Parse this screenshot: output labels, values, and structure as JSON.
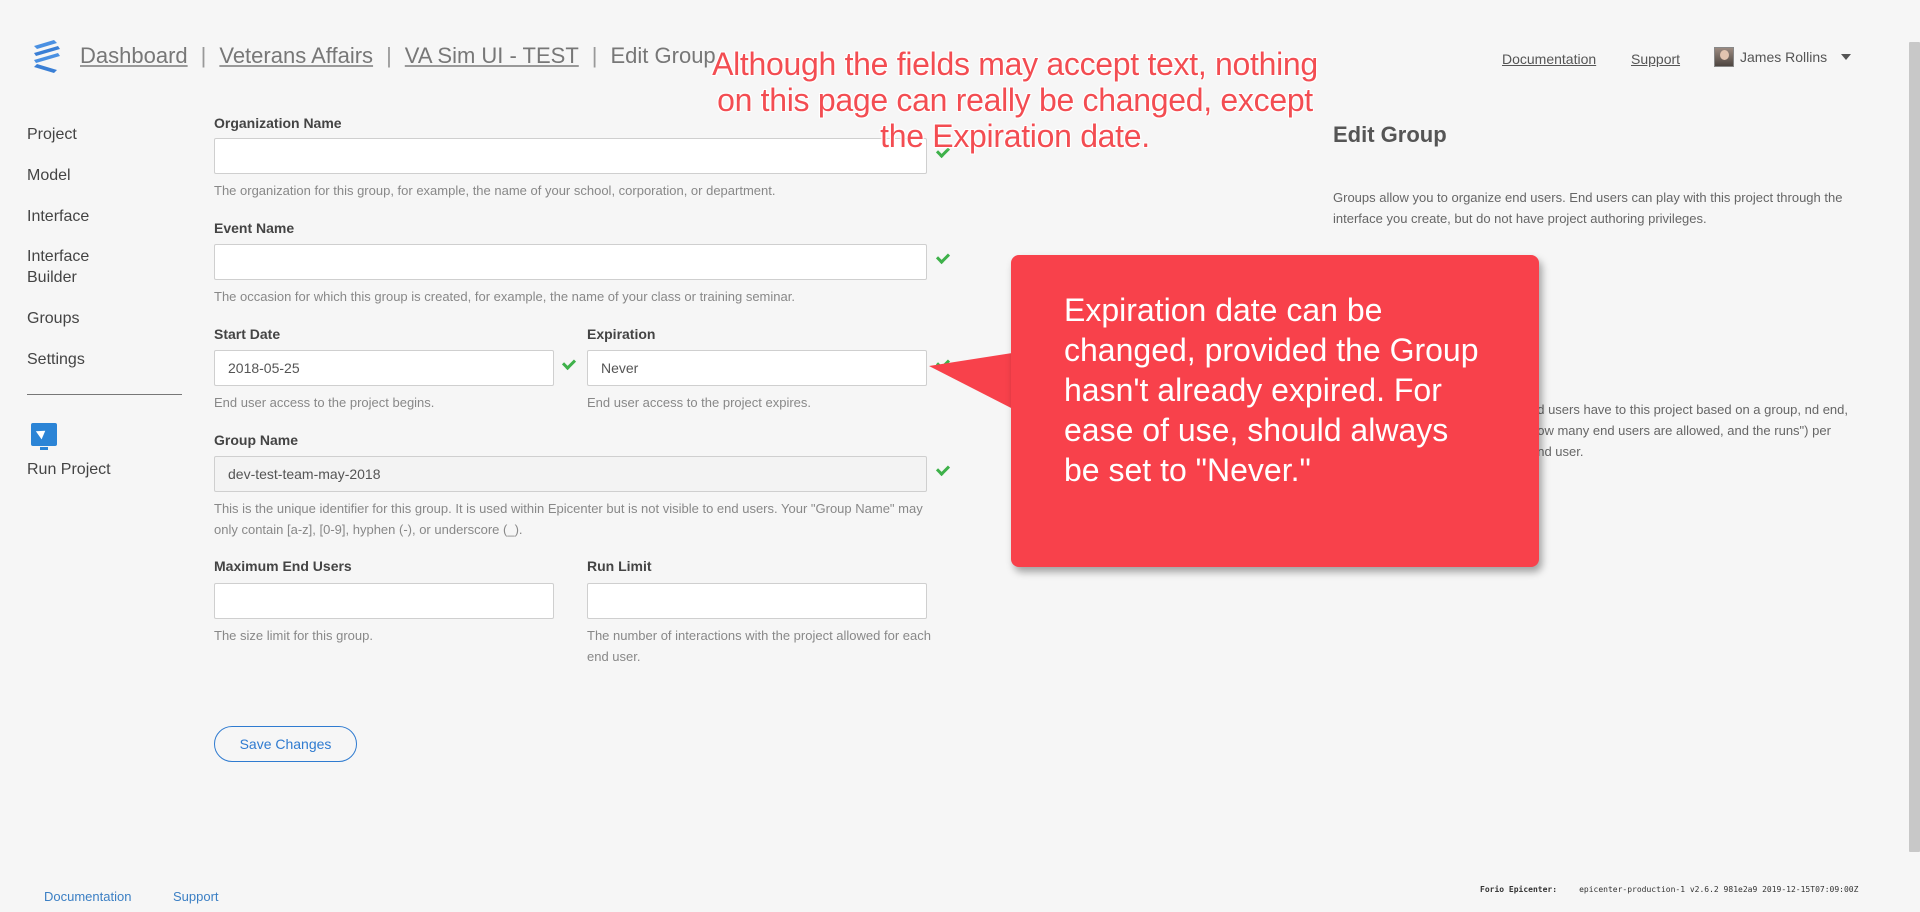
{
  "header": {
    "breadcrumbs": [
      "Dashboard",
      "Veterans Affairs",
      "VA Sim UI - TEST"
    ],
    "current_page": "Edit Group",
    "separator": "|",
    "links": {
      "documentation": "Documentation",
      "support": "Support"
    },
    "user_name": "James Rollins"
  },
  "sidebar": {
    "items": [
      "Project",
      "Model",
      "Interface",
      "Interface Builder",
      "Groups",
      "Settings"
    ],
    "run_project": "Run Project"
  },
  "form": {
    "org_name": {
      "label": "Organization Name",
      "value": "",
      "help": "The organization for this group, for example, the name of your school, corporation, or department."
    },
    "event_name": {
      "label": "Event Name",
      "value": "",
      "help": "The occasion for which this group is created, for example, the name of your class or training seminar."
    },
    "start_date": {
      "label": "Start Date",
      "value": "2018-05-25",
      "help": "End user access to the project begins."
    },
    "expiration": {
      "label": "Expiration",
      "value": "Never",
      "help": "End user access to the project expires."
    },
    "group_name": {
      "label": "Group Name",
      "value": "dev-test-team-may-2018",
      "help": "This is the unique identifier for this group. It is used within Epicenter but is not visible to end users. Your \"Group Name\" may only contain [a-z], [0-9], hyphen (-), or underscore (_)."
    },
    "max_users": {
      "label": "Maximum End Users",
      "value": "",
      "help": "The size limit for this group."
    },
    "run_limit": {
      "label": "Run Limit",
      "value": "",
      "help": "The number of interactions with the project allowed for each end user."
    },
    "save_label": "Save Changes"
  },
  "panel": {
    "title": "Edit Group",
    "para1": "Groups allow you to organize end users. End users can play with this project through the interface you create, but do not have project authoring privileges.",
    "para2": "nd users have to this project based on a group, nd end, how many end users are allowed, and the runs\") per end user."
  },
  "annotations": {
    "top_note": "Although the fields may accept text, nothing on this page can really be changed, except the Expiration date.",
    "callout": "Expiration date can be changed, provided the Group hasn't already expired. For ease of use, should always be set to \"Never.\"",
    "top_note_color": "#f34d52",
    "callout_color": "#f8414b"
  },
  "footer": {
    "documentation": "Documentation",
    "support": "Support",
    "brand": "Forio Epicenter:",
    "build": "epicenter-production-1 v2.6.2 981e2a9 2019-12-15T07:09:00Z"
  }
}
